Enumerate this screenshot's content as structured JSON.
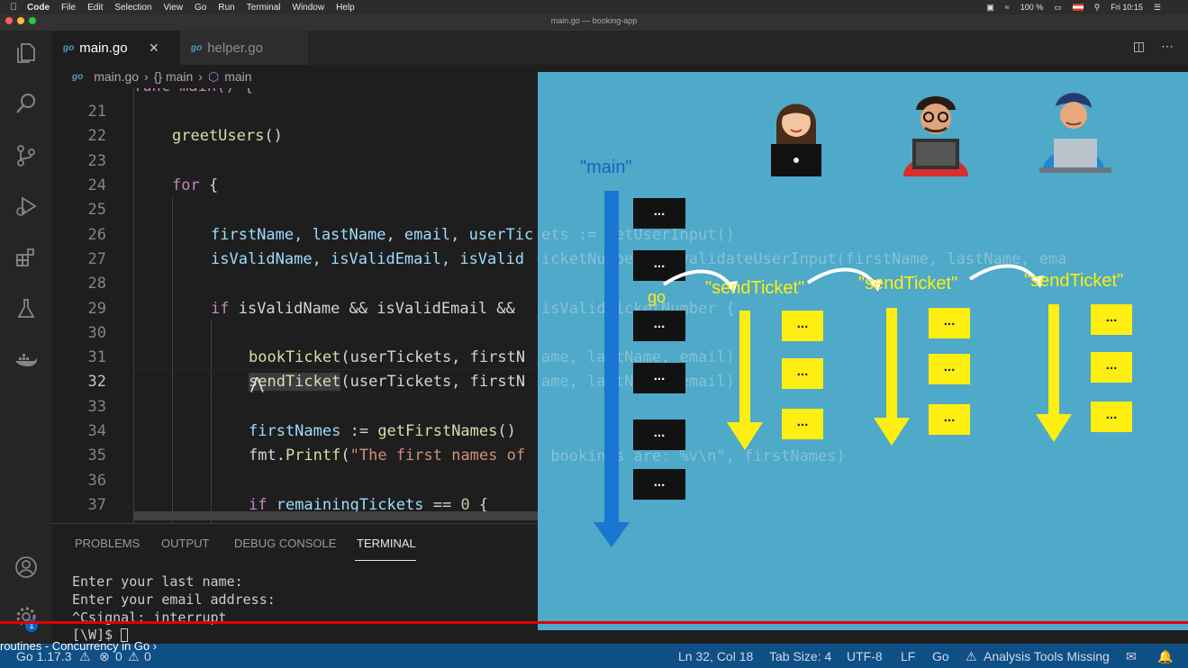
{
  "menubar": {
    "app": "Code",
    "items": [
      "File",
      "Edit",
      "Selection",
      "View",
      "Go",
      "Run",
      "Terminal",
      "Window",
      "Help"
    ],
    "battery": "100 %",
    "clock": "Fri 10:15"
  },
  "window": {
    "title": "main.go — booking-app"
  },
  "tabs": [
    {
      "label": "main.go",
      "active": true
    },
    {
      "label": "helper.go",
      "active": false
    }
  ],
  "tab_icon": "go",
  "breadcrumb": {
    "file": "main.go",
    "scope1": "{} main",
    "scope2": "main"
  },
  "editor": {
    "partial_top": "func main() {",
    "lines": [
      {
        "n": "21"
      },
      {
        "n": "22"
      },
      {
        "n": "23"
      },
      {
        "n": "24"
      },
      {
        "n": "25"
      },
      {
        "n": "26"
      },
      {
        "n": "27"
      },
      {
        "n": "28"
      },
      {
        "n": "29"
      },
      {
        "n": "30"
      },
      {
        "n": "31"
      },
      {
        "n": "32"
      },
      {
        "n": "33"
      },
      {
        "n": "34"
      },
      {
        "n": "35"
      },
      {
        "n": "36"
      },
      {
        "n": "37"
      }
    ],
    "code": {
      "l22": "greetUsers",
      "l22_rest": "()",
      "l24_kw": "for",
      "l24_rest": " {",
      "l26": "firstName, lastName, email, userTic",
      "l27": "isValidName, isValidEmail, isValid",
      "l29_kw": "if",
      "l29_rest": " isValidName && isValidEmail &&",
      "l31_fn": "bookTicket",
      "l31_rest": "(userTickets, firstN",
      "l32_fn": "sendTicket",
      "l32_rest": "(userTickets, firstN",
      "l34_var": "firstNames",
      "l34_op": " := ",
      "l34_fn": "getFirstNames",
      "l34_rest": "()",
      "l35_pkg": "fmt.",
      "l35_fn": "Printf",
      "l35_p": "(",
      "l35_str": "\"The first names of",
      "l37_kw": "if",
      "l37_var": " remainingTickets",
      "l37_op": " == ",
      "l37_num": "0",
      "l37_rest": " {"
    },
    "ghost_code": {
      "g26": "ets := getUserInput()",
      "g27": "icketNumber := validateUserInput(firstName, lastName, ema",
      "g29": "isValidTicketNumber {",
      "g31": "ame, lastName, email)",
      "g32": "ame, lastName, email)",
      "g35": " bookings are: %v\\n\", firstNames)"
    }
  },
  "panel": {
    "tabs": [
      "PROBLEMS",
      "OUTPUT",
      "DEBUG CONSOLE",
      "TERMINAL"
    ],
    "active_tab": "TERMINAL",
    "terminal_lines": [
      "Enter your last name:",
      "Enter your email address:",
      "^Csignal: interrupt",
      "[\\W]$ "
    ]
  },
  "statusbar": {
    "go_version": "Go 1.17.3",
    "errors": "0",
    "warnings": "0",
    "position": "Ln 32, Col 18",
    "tab_size": "Tab Size: 4",
    "encoding": "UTF-8",
    "eol": "LF",
    "language": "Go",
    "analysis": "Analysis Tools Missing"
  },
  "video_title": "routines - Concurrency in Go",
  "accounts_badge": "1",
  "slide": {
    "main_label": "\"main\"",
    "go_label": "go",
    "thread_labels": [
      "\"sendTicket\"",
      "\"sendTicket\"",
      "\"sendTicket\""
    ],
    "block_text": "...",
    "main_blocks": 6,
    "colors": {
      "background": "#4fa9c8",
      "main_arrow": "#1976d2",
      "goroutine": "#ffee11",
      "block": "#121212"
    }
  },
  "colors": {
    "editor_bg": "#1e1e1e",
    "statusbar": "#0e4f86",
    "keyword": "#c586c0",
    "function": "#dcdcaa",
    "variable": "#9cdcfe",
    "string": "#ce9178",
    "progress": "#e00000"
  }
}
